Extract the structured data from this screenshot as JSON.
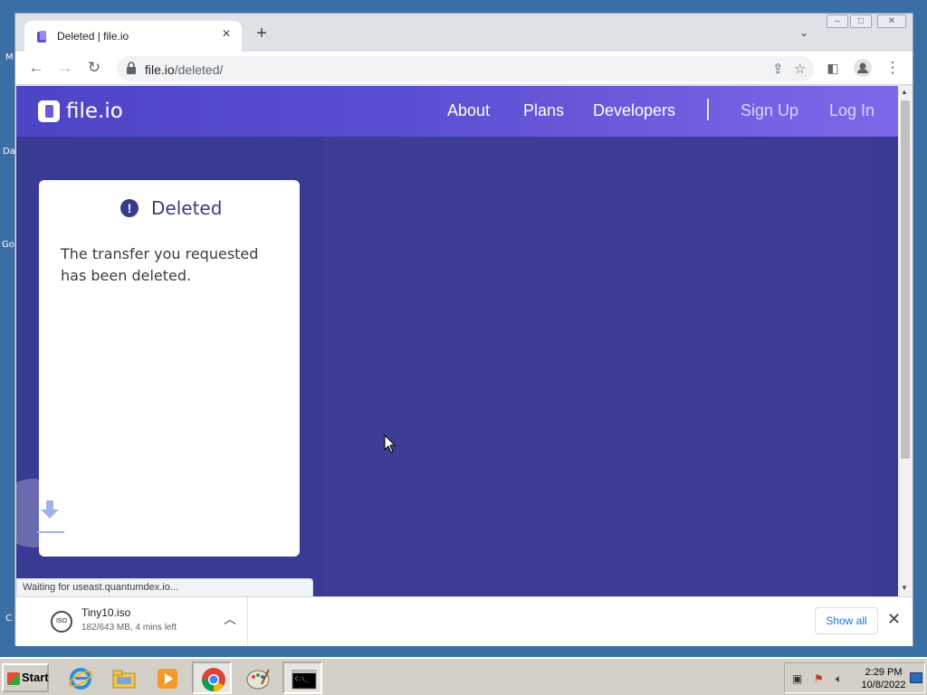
{
  "browser": {
    "tab_title": "Deleted | file.io",
    "new_tab_label": "+",
    "url_host": "file.io",
    "url_path": "/deleted/"
  },
  "site": {
    "logo_text": "file.io",
    "nav": {
      "about": "About",
      "plans": "Plans",
      "developers": "Developers",
      "sign_up": "Sign Up",
      "log_in": "Log In"
    },
    "card": {
      "heading": "Deleted",
      "message": "The transfer you requested has been deleted."
    },
    "colors": {
      "page_bg": "#393a93",
      "header_start": "#4e44c6",
      "header_end": "#7e68ea",
      "card_heading": "#3a3a8c"
    }
  },
  "status_bubble": "Waiting for useast.quantumdex.io...",
  "download_shelf": {
    "file_name": "Tiny10.iso",
    "file_icon_label": "ISO",
    "progress_text": "182/643 MB, 4 mins left",
    "show_all_label": "Show all"
  },
  "taskbar": {
    "start_label": "Start",
    "clock_time": "2:29 PM",
    "clock_date": "10/8/2022",
    "apps": [
      "internet-explorer-icon",
      "file-explorer-icon",
      "media-player-icon",
      "chrome-icon",
      "paint-icon",
      "command-prompt-icon"
    ]
  },
  "desktop_labels": [
    "M",
    "Da",
    "Go",
    "C"
  ]
}
